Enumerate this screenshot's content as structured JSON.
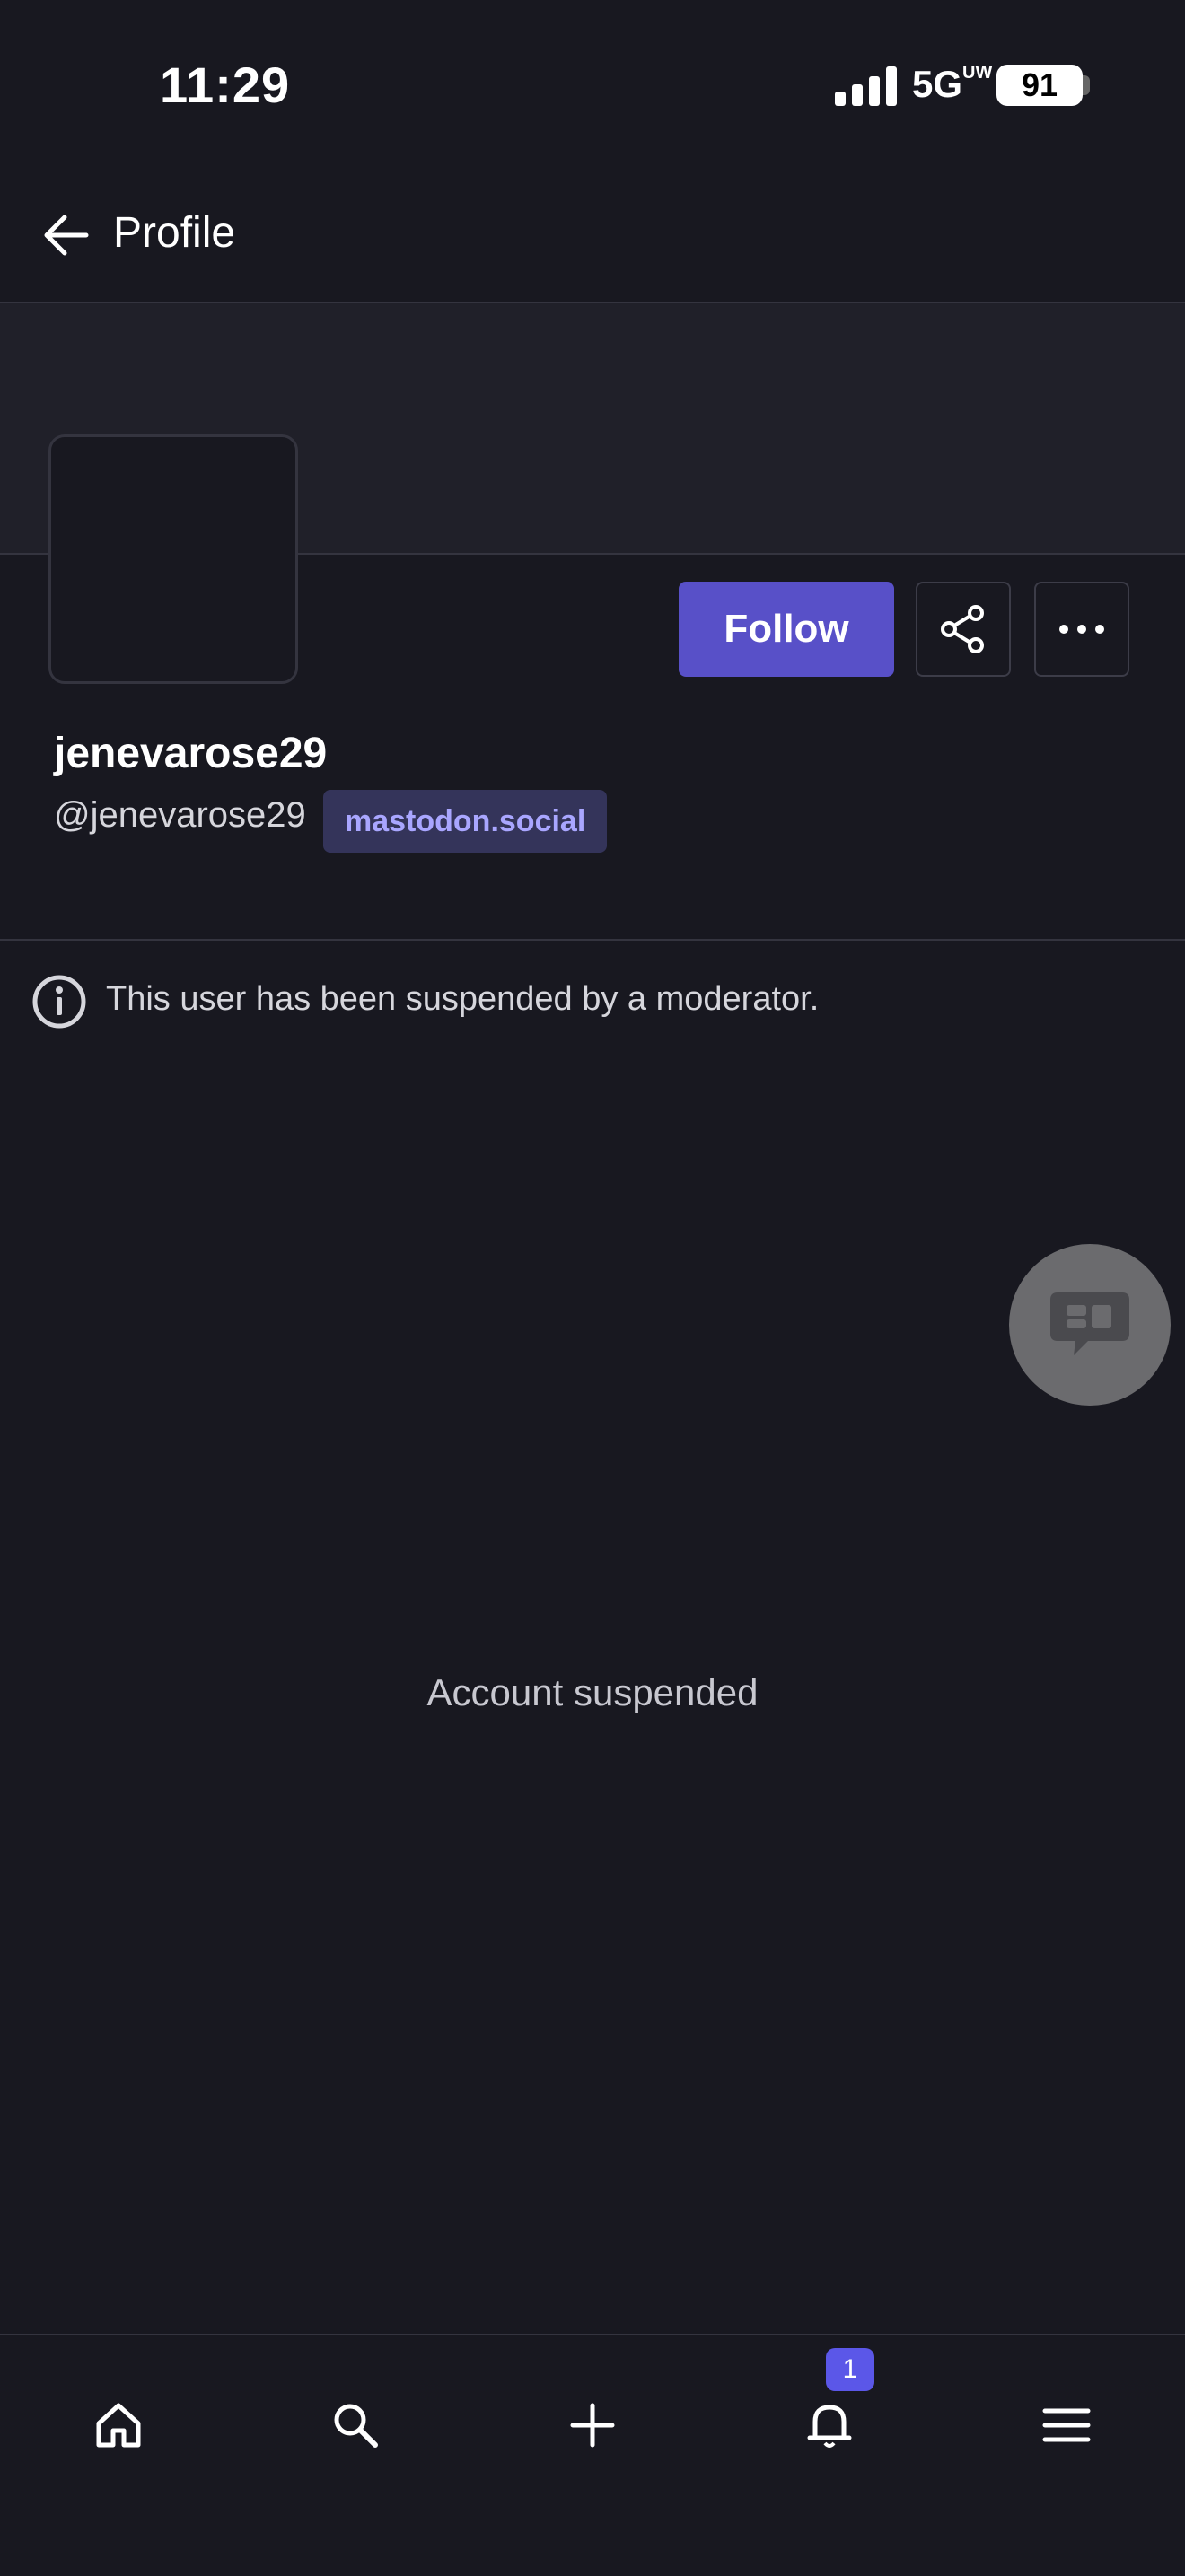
{
  "status_bar": {
    "time": "11:29",
    "network": "5G",
    "network_sup": "UW",
    "battery": "91"
  },
  "header": {
    "title": "Profile"
  },
  "profile": {
    "display_name": "jenevarose29",
    "handle": "@jenevarose29",
    "domain": "mastodon.social",
    "follow_label": "Follow"
  },
  "notice": {
    "text": "This user has been suspended by a moderator."
  },
  "content": {
    "empty_state": "Account suspended"
  },
  "bottom_nav": {
    "notification_count": "1"
  },
  "colors": {
    "background": "#181820",
    "accent": "#5850c8",
    "badge": "#5b57e8",
    "domain_text": "#a9a6ff"
  }
}
